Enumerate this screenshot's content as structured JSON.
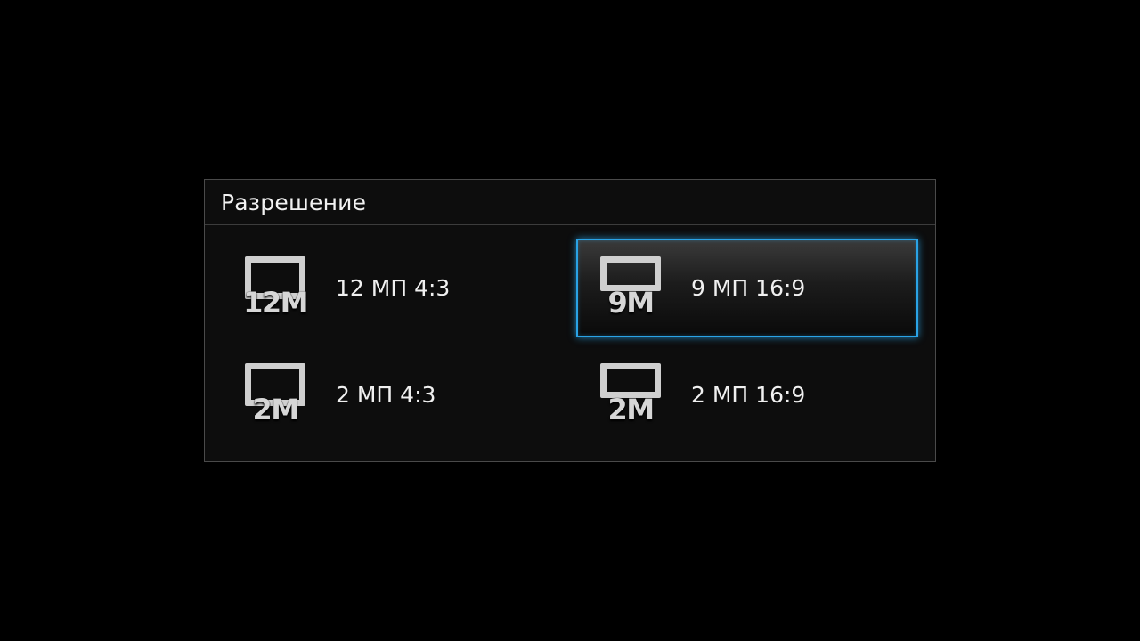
{
  "dialog": {
    "title": "Разрешение"
  },
  "options": [
    {
      "icon_text": "12M",
      "label": "12 МП 4:3",
      "aspect": "4:3",
      "selected": false,
      "icon": "resolution-12m-4x3-icon"
    },
    {
      "icon_text": "9M",
      "label": "9 МП 16:9",
      "aspect": "16:9",
      "selected": true,
      "icon": "resolution-9m-16x9-icon"
    },
    {
      "icon_text": "2M",
      "label": "2 МП 4:3",
      "aspect": "4:3",
      "selected": false,
      "icon": "resolution-2m-4x3-icon"
    },
    {
      "icon_text": "2M",
      "label": "2 МП 16:9",
      "aspect": "16:9",
      "selected": false,
      "icon": "resolution-2m-16x9-icon"
    }
  ],
  "colors": {
    "background": "#000000",
    "dialog_bg": "#0d0d0d",
    "selection_border": "#2aa3e6",
    "icon": "#cfcfcf",
    "text": "#f0f0f0"
  }
}
